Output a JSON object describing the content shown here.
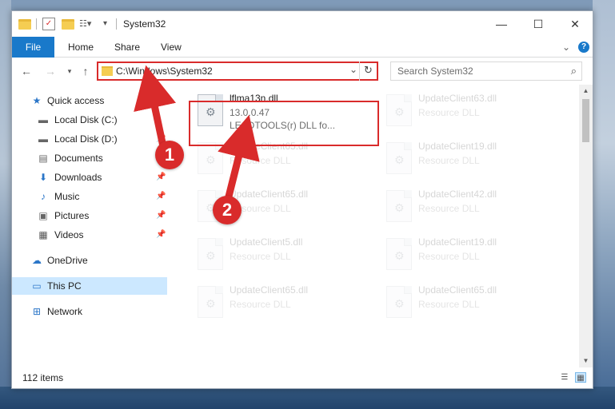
{
  "window": {
    "title": "System32",
    "minimize": "—",
    "maximize": "☐",
    "close": "✕"
  },
  "ribbon": {
    "tabs": [
      "File",
      "Home",
      "Share",
      "View"
    ],
    "collapse": "⌄",
    "help": "?"
  },
  "address": {
    "path": "C:\\Windows\\System32",
    "search_placeholder": "Search System32"
  },
  "nav": {
    "items": [
      {
        "label": "Quick access",
        "icon": "star-icon"
      },
      {
        "label": "Local Disk (C:)",
        "icon": "drive-icon"
      },
      {
        "label": "Local Disk (D:)",
        "icon": "drive-icon"
      },
      {
        "label": "Documents",
        "icon": "documents-icon"
      },
      {
        "label": "Downloads",
        "icon": "downloads-icon"
      },
      {
        "label": "Music",
        "icon": "music-icon"
      },
      {
        "label": "Pictures",
        "icon": "pictures-icon"
      },
      {
        "label": "Videos",
        "icon": "videos-icon"
      },
      {
        "label": "OneDrive",
        "icon": "cloud-icon"
      },
      {
        "label": "This PC",
        "icon": "computer-icon"
      },
      {
        "label": "Network",
        "icon": "network-icon"
      }
    ]
  },
  "files": {
    "highlighted": {
      "name": "lflma13n.dll",
      "version": "13.0.0.47",
      "description": "LEADTOOLS(r) DLL fo..."
    },
    "tiles": [
      {
        "name": "UpdateClient63.dll",
        "type": "Resource DLL"
      },
      {
        "name": "UpdateClient65.dll",
        "type": "Resource DLL"
      },
      {
        "name": "UpdateClient19.dll",
        "type": "Resource DLL"
      },
      {
        "name": "UpdateClient65.dll",
        "type": "Resource DLL"
      },
      {
        "name": "UpdateClient42.dll",
        "type": "Resource DLL"
      },
      {
        "name": "UpdateClient5.dll",
        "type": "Resource DLL"
      },
      {
        "name": "UpdateClient19.dll",
        "type": "Resource DLL"
      },
      {
        "name": "UpdateClient65.dll",
        "type": "Resource DLL"
      },
      {
        "name": "UpdateClient65.dll",
        "type": "Resource DLL"
      }
    ]
  },
  "status": {
    "item_count": "112 items"
  },
  "annotations": {
    "step1": "1",
    "step2": "2"
  },
  "colors": {
    "accent": "#1979ca",
    "annotation_red": "#d92b2b",
    "selected_nav": "#cce8ff"
  }
}
